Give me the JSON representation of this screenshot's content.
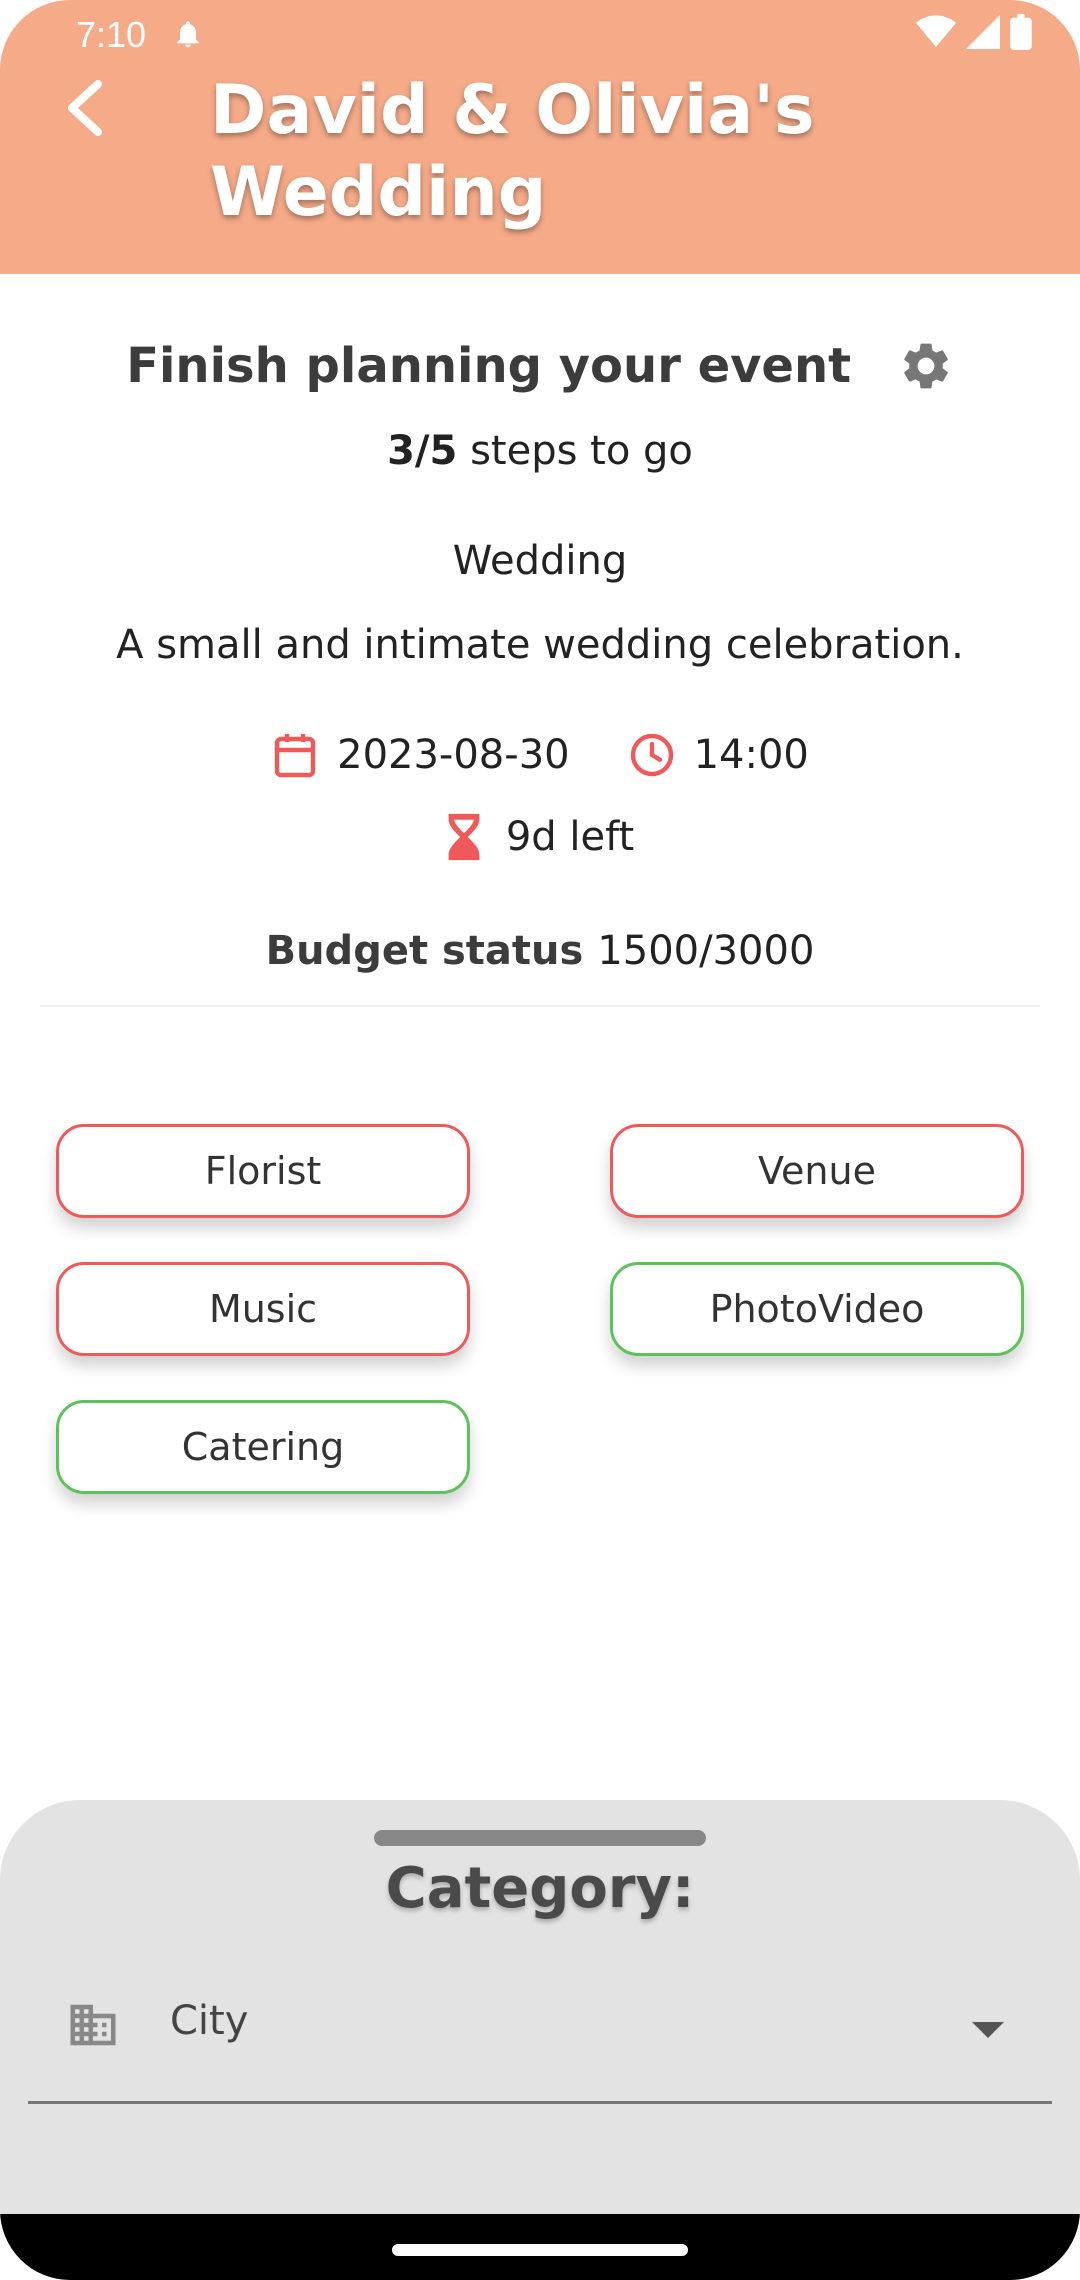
{
  "status_bar": {
    "time": "7:10"
  },
  "header": {
    "title": "David & Olivia's Wedding"
  },
  "progress": {
    "heading": "Finish planning your event",
    "steps_count": "3/5",
    "steps_suffix": " steps to go",
    "completed_steps": 2,
    "total_steps": 5
  },
  "event": {
    "type": "Wedding",
    "description": "A small and intimate wedding celebration.",
    "date": "2023-08-30",
    "time": "14:00",
    "time_left": "9d left"
  },
  "budget": {
    "label": "Budget status",
    "value": "1500/3000"
  },
  "categories": [
    {
      "label": "Florist",
      "status": "pending"
    },
    {
      "label": "Venue",
      "status": "pending"
    },
    {
      "label": "Music",
      "status": "pending"
    },
    {
      "label": "PhotoVideo",
      "status": "done"
    },
    {
      "label": "Catering",
      "status": "done"
    }
  ],
  "sheet": {
    "title": "Category:",
    "field_value": "City"
  },
  "colors": {
    "header_bg": "#F5AA88",
    "accent_red": "#EE5A5A",
    "accent_green": "#5CC25A",
    "sheet_bg": "#E3E3E3"
  },
  "icons": [
    "back-arrow-icon",
    "bell-icon",
    "wifi-icon",
    "signal-icon",
    "battery-icon",
    "gear-icon",
    "calendar-icon",
    "clock-icon",
    "hourglass-icon",
    "building-icon",
    "dropdown-arrow-icon"
  ]
}
